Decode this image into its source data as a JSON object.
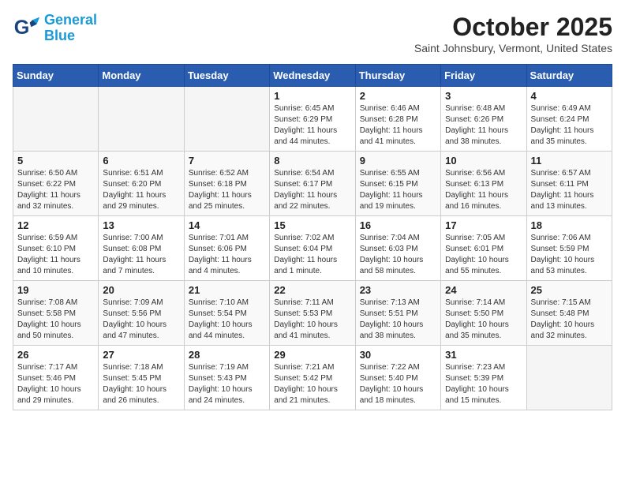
{
  "logo": {
    "text_general": "General",
    "text_blue": "Blue"
  },
  "title": "October 2025",
  "location": "Saint Johnsbury, Vermont, United States",
  "days_of_week": [
    "Sunday",
    "Monday",
    "Tuesday",
    "Wednesday",
    "Thursday",
    "Friday",
    "Saturday"
  ],
  "weeks": [
    [
      {
        "day": "",
        "info": ""
      },
      {
        "day": "",
        "info": ""
      },
      {
        "day": "",
        "info": ""
      },
      {
        "day": "1",
        "info": "Sunrise: 6:45 AM\nSunset: 6:29 PM\nDaylight: 11 hours\nand 44 minutes."
      },
      {
        "day": "2",
        "info": "Sunrise: 6:46 AM\nSunset: 6:28 PM\nDaylight: 11 hours\nand 41 minutes."
      },
      {
        "day": "3",
        "info": "Sunrise: 6:48 AM\nSunset: 6:26 PM\nDaylight: 11 hours\nand 38 minutes."
      },
      {
        "day": "4",
        "info": "Sunrise: 6:49 AM\nSunset: 6:24 PM\nDaylight: 11 hours\nand 35 minutes."
      }
    ],
    [
      {
        "day": "5",
        "info": "Sunrise: 6:50 AM\nSunset: 6:22 PM\nDaylight: 11 hours\nand 32 minutes."
      },
      {
        "day": "6",
        "info": "Sunrise: 6:51 AM\nSunset: 6:20 PM\nDaylight: 11 hours\nand 29 minutes."
      },
      {
        "day": "7",
        "info": "Sunrise: 6:52 AM\nSunset: 6:18 PM\nDaylight: 11 hours\nand 25 minutes."
      },
      {
        "day": "8",
        "info": "Sunrise: 6:54 AM\nSunset: 6:17 PM\nDaylight: 11 hours\nand 22 minutes."
      },
      {
        "day": "9",
        "info": "Sunrise: 6:55 AM\nSunset: 6:15 PM\nDaylight: 11 hours\nand 19 minutes."
      },
      {
        "day": "10",
        "info": "Sunrise: 6:56 AM\nSunset: 6:13 PM\nDaylight: 11 hours\nand 16 minutes."
      },
      {
        "day": "11",
        "info": "Sunrise: 6:57 AM\nSunset: 6:11 PM\nDaylight: 11 hours\nand 13 minutes."
      }
    ],
    [
      {
        "day": "12",
        "info": "Sunrise: 6:59 AM\nSunset: 6:10 PM\nDaylight: 11 hours\nand 10 minutes."
      },
      {
        "day": "13",
        "info": "Sunrise: 7:00 AM\nSunset: 6:08 PM\nDaylight: 11 hours\nand 7 minutes."
      },
      {
        "day": "14",
        "info": "Sunrise: 7:01 AM\nSunset: 6:06 PM\nDaylight: 11 hours\nand 4 minutes."
      },
      {
        "day": "15",
        "info": "Sunrise: 7:02 AM\nSunset: 6:04 PM\nDaylight: 11 hours\nand 1 minute."
      },
      {
        "day": "16",
        "info": "Sunrise: 7:04 AM\nSunset: 6:03 PM\nDaylight: 10 hours\nand 58 minutes."
      },
      {
        "day": "17",
        "info": "Sunrise: 7:05 AM\nSunset: 6:01 PM\nDaylight: 10 hours\nand 55 minutes."
      },
      {
        "day": "18",
        "info": "Sunrise: 7:06 AM\nSunset: 5:59 PM\nDaylight: 10 hours\nand 53 minutes."
      }
    ],
    [
      {
        "day": "19",
        "info": "Sunrise: 7:08 AM\nSunset: 5:58 PM\nDaylight: 10 hours\nand 50 minutes."
      },
      {
        "day": "20",
        "info": "Sunrise: 7:09 AM\nSunset: 5:56 PM\nDaylight: 10 hours\nand 47 minutes."
      },
      {
        "day": "21",
        "info": "Sunrise: 7:10 AM\nSunset: 5:54 PM\nDaylight: 10 hours\nand 44 minutes."
      },
      {
        "day": "22",
        "info": "Sunrise: 7:11 AM\nSunset: 5:53 PM\nDaylight: 10 hours\nand 41 minutes."
      },
      {
        "day": "23",
        "info": "Sunrise: 7:13 AM\nSunset: 5:51 PM\nDaylight: 10 hours\nand 38 minutes."
      },
      {
        "day": "24",
        "info": "Sunrise: 7:14 AM\nSunset: 5:50 PM\nDaylight: 10 hours\nand 35 minutes."
      },
      {
        "day": "25",
        "info": "Sunrise: 7:15 AM\nSunset: 5:48 PM\nDaylight: 10 hours\nand 32 minutes."
      }
    ],
    [
      {
        "day": "26",
        "info": "Sunrise: 7:17 AM\nSunset: 5:46 PM\nDaylight: 10 hours\nand 29 minutes."
      },
      {
        "day": "27",
        "info": "Sunrise: 7:18 AM\nSunset: 5:45 PM\nDaylight: 10 hours\nand 26 minutes."
      },
      {
        "day": "28",
        "info": "Sunrise: 7:19 AM\nSunset: 5:43 PM\nDaylight: 10 hours\nand 24 minutes."
      },
      {
        "day": "29",
        "info": "Sunrise: 7:21 AM\nSunset: 5:42 PM\nDaylight: 10 hours\nand 21 minutes."
      },
      {
        "day": "30",
        "info": "Sunrise: 7:22 AM\nSunset: 5:40 PM\nDaylight: 10 hours\nand 18 minutes."
      },
      {
        "day": "31",
        "info": "Sunrise: 7:23 AM\nSunset: 5:39 PM\nDaylight: 10 hours\nand 15 minutes."
      },
      {
        "day": "",
        "info": ""
      }
    ]
  ]
}
